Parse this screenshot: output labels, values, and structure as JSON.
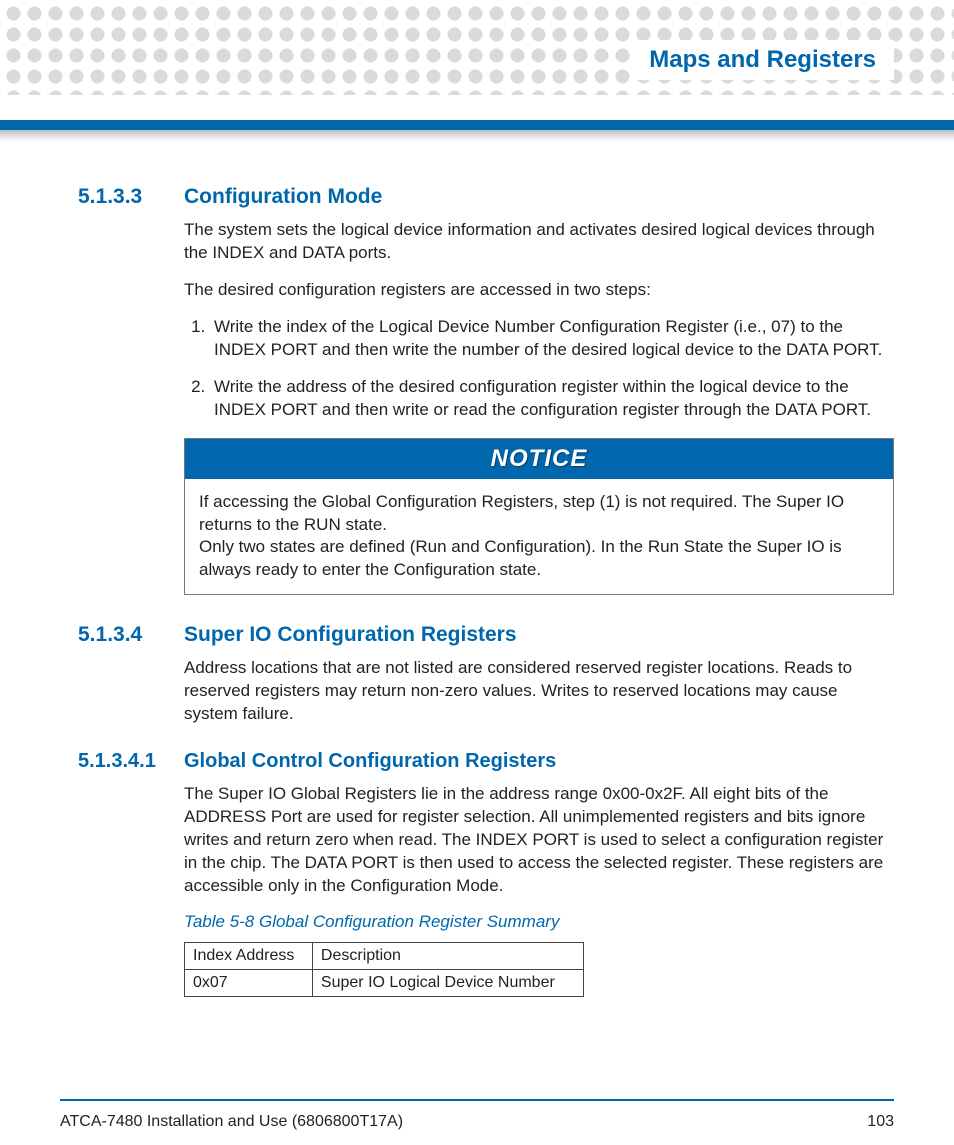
{
  "header": {
    "title": "Maps and Registers"
  },
  "sections": {
    "s5133": {
      "num": "5.1.3.3",
      "title": "Configuration Mode",
      "p1": "The system sets the logical device information and activates desired logical devices through the INDEX and DATA ports.",
      "p2": "The desired configuration registers are accessed in two steps:",
      "li1": "Write the index of the Logical Device Number Configuration Register (i.e., 07) to the INDEX PORT and then write the number of the desired logical device to the DATA PORT.",
      "li2": "Write the address of the desired configuration register within the logical device to the INDEX PORT and then write or read the configuration register through the DATA PORT."
    },
    "notice": {
      "label": "NOTICE",
      "line1": "If accessing the Global Configuration Registers, step (1) is not required. The Super IO returns to the RUN state.",
      "line2": "Only two states are defined (Run and Configuration). In the Run State the Super IO is always ready to enter the Configuration state."
    },
    "s5134": {
      "num": "5.1.3.4",
      "title": "Super IO Configuration Registers",
      "p1": "Address locations that are not listed are considered reserved register locations. Reads to reserved registers may return non-zero values. Writes to reserved locations may cause system failure."
    },
    "s51341": {
      "num": "5.1.3.4.1",
      "title": "Global Control Configuration Registers",
      "p1": "The Super IO Global Registers lie in the address range 0x00-0x2F. All eight bits of the ADDRESS Port are used for register selection. All unimplemented registers and bits ignore writes and return zero when read. The INDEX PORT is used to select a configuration register in the chip. The DATA PORT is then used to access the selected register. These registers are accessible only in the Configuration Mode."
    },
    "table": {
      "caption": "Table 5-8 Global Configuration Register Summary",
      "h1": "Index Address",
      "h2": "Description",
      "r1c1": "0x07",
      "r1c2": "Super IO Logical Device Number"
    }
  },
  "footer": {
    "left": "ATCA-7480 Installation and Use (6806800T17A)",
    "right": "103"
  }
}
